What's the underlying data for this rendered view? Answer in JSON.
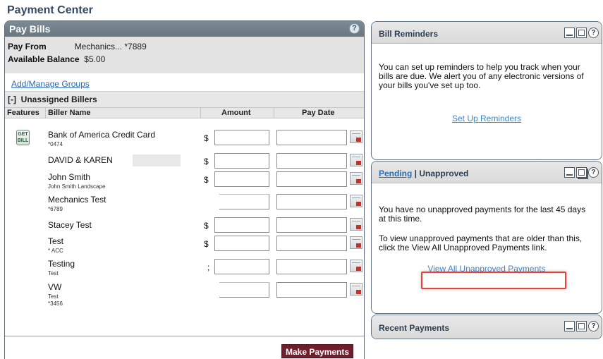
{
  "page": {
    "title": "Payment Center"
  },
  "pay_bills": {
    "title": "Pay Bills",
    "help_label": "?",
    "pay_from_label": "Pay From",
    "pay_from_value": "Mechanics... *7889",
    "balance_label": "Available Balance",
    "balance_value": "$5.00",
    "groups_link": "Add/Manage Groups",
    "unassigned_toggle": "[-]",
    "unassigned_title": "Unassigned Billers",
    "columns": {
      "features": "Features",
      "biller_name": "Biller Name",
      "amount": "Amount",
      "pay_date": "Pay Date"
    },
    "get_bill_icon_text": "GET BILL",
    "billers": [
      {
        "name": "Bank of America Credit Card",
        "sub": "*0474",
        "currency": "$",
        "get_bill": true
      },
      {
        "name": "DAVID & KAREN",
        "sub": "",
        "currency": "$",
        "redacted": true
      },
      {
        "name": "John Smith",
        "sub": "John Smith Landscape",
        "currency": "$"
      },
      {
        "name": "Mechanics Test",
        "sub": "*6789",
        "currency": ""
      },
      {
        "name": "Stacey Test",
        "sub": "",
        "currency": "$"
      },
      {
        "name": "Test",
        "sub": "* ACC",
        "currency": "$"
      },
      {
        "name": "Testing",
        "sub": "Test",
        "currency": ";"
      },
      {
        "name": "VW",
        "sub": "Test",
        "sub2": "*3456",
        "currency": ""
      }
    ],
    "make_payments_label": "Make Payments"
  },
  "bill_reminders": {
    "title": "Bill Reminders",
    "body": "You can set up reminders to help you track when your bills are due. We alert you of any electronic versions of your bills you've set up too.",
    "link": "Set Up Reminders"
  },
  "pending": {
    "tab_pending": "Pending",
    "separator": " | ",
    "tab_unapproved": "Unapproved",
    "body1": "You have no unapproved payments for the last 45 days at this time.",
    "body2": "To view unapproved payments that are older than this, click the View All Unapproved Payments link.",
    "link": "View All Unapproved Payments"
  },
  "recent_payments": {
    "title": "Recent Payments"
  },
  "panel_icons": {
    "minimize": "minimize-icon",
    "maximize": "maximize-icon",
    "help": "?"
  },
  "colors": {
    "header_bar": "#6a7781",
    "make_payments_bg": "#6f1f2c",
    "link": "#2b6cb0",
    "highlight": "#e0443e"
  }
}
